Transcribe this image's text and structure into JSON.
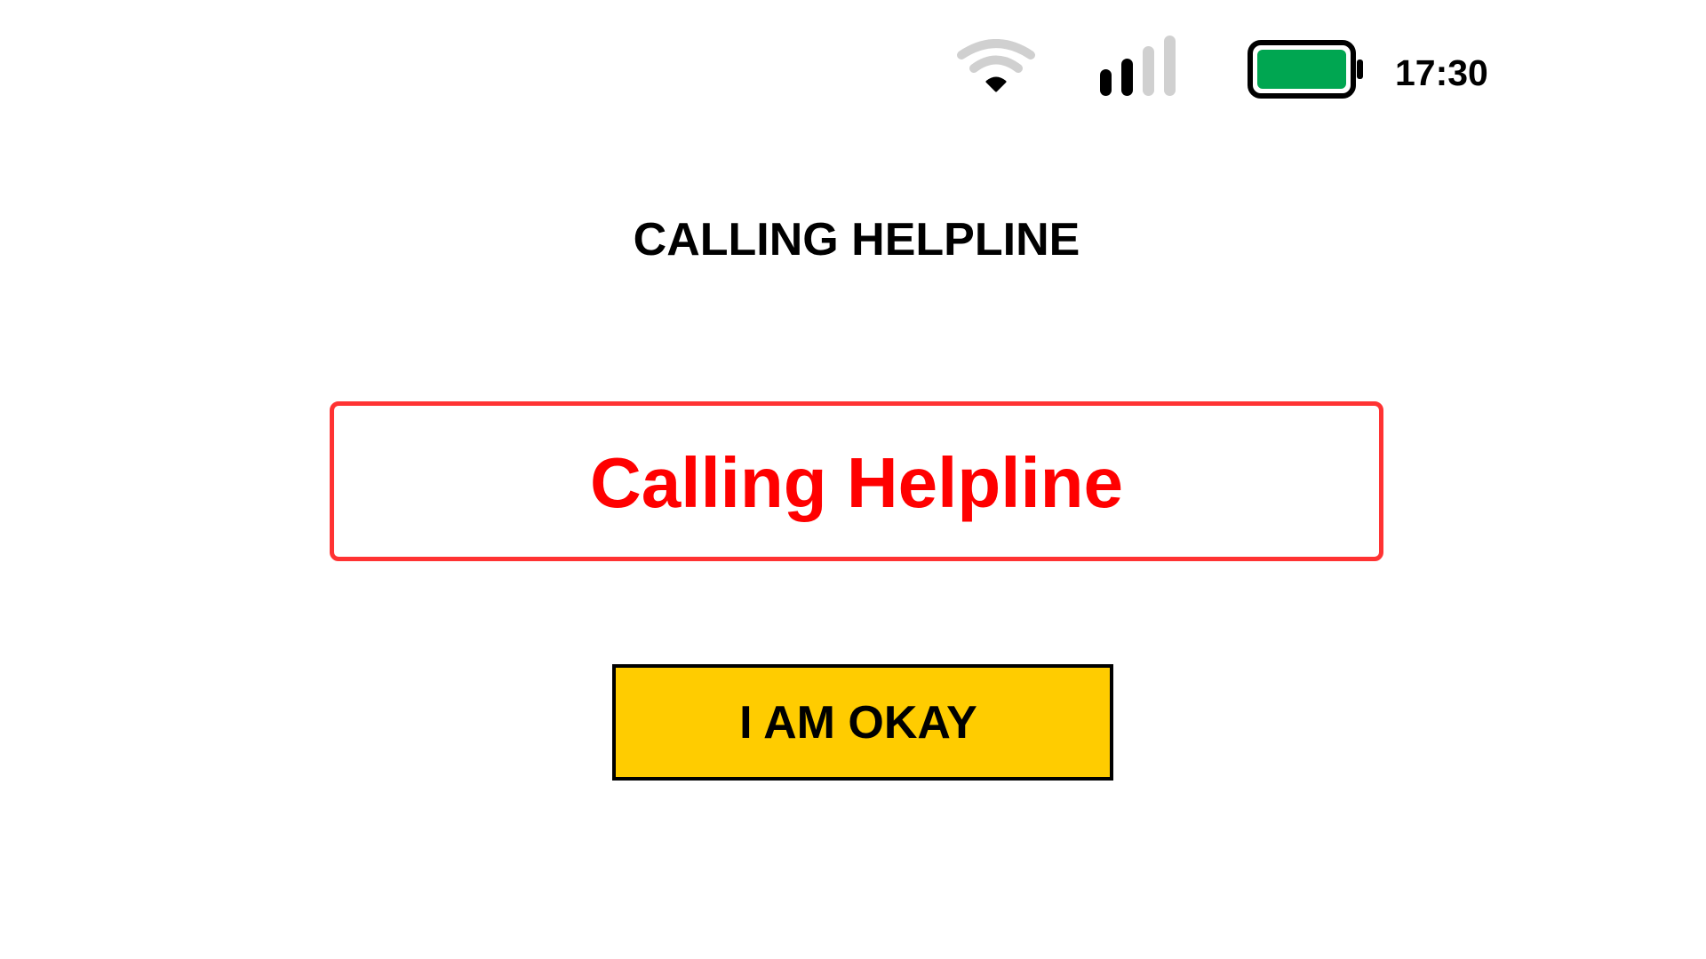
{
  "status_bar": {
    "time": "17:30",
    "wifi_icon": "wifi-icon",
    "signal_icon": "cellular-signal-icon",
    "signal_bars_active": 2,
    "signal_bars_total": 4,
    "battery_icon": "battery-icon",
    "battery_level": 1.0,
    "battery_color": "#00a651"
  },
  "header": {
    "title": "CALLING HELPLINE"
  },
  "status_card": {
    "text": "Calling Helpline",
    "border_color": "#ff3333",
    "text_color": "#ff0000"
  },
  "actions": {
    "okay_label": "I AM OKAY",
    "okay_color": "#ffcc00"
  }
}
